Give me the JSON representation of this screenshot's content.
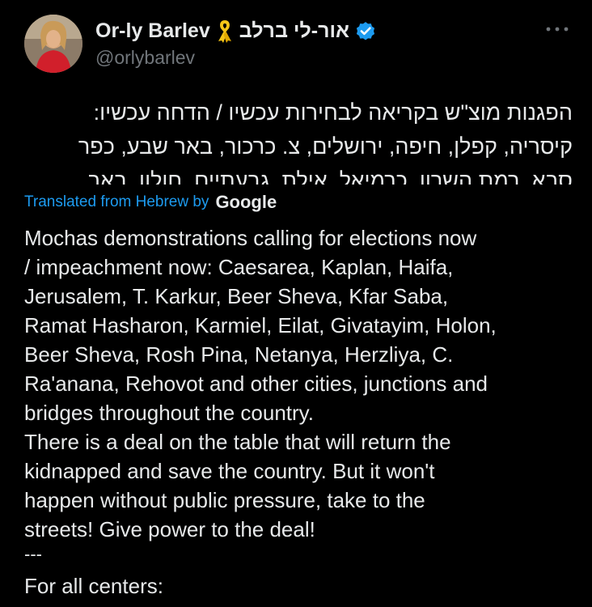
{
  "author": {
    "display_name": "Or-ly Barlev",
    "hebrew_name": "אור-לי ברלב",
    "handle": "@orlybarlev",
    "avatar_icon": "profile-photo",
    "ribbon_icon": "yellow-ribbon-icon",
    "verified_icon": "verified-badge-icon",
    "verified_color": "#1d9bf0",
    "ribbon_color": "#f5c518"
  },
  "tweet": {
    "hebrew_lines": [
      "הפגנות מוצ\"ש בקריאה לבחירות עכשיו / הדחה עכשיו:",
      "קיסריה, קפלן, חיפה, ירושלים, צ. כרכור, באר שבע, כפר",
      "סבא, רמת השרון, כרמיאל, אילת, גבעתיים, חולון, באר"
    ],
    "translated_label": "Translated from Hebrew by",
    "translator": "Google",
    "english_lines": [
      "Mochas demonstrations calling for elections now",
      "/ impeachment now: Caesarea, Kaplan, Haifa,",
      "Jerusalem, T. Karkur, Beer Sheva, Kfar Saba,",
      "Ramat Hasharon, Karmiel, Eilat, Givatayim, Holon,",
      "Beer Sheva, Rosh Pina, Netanya, Herzliya, C.",
      "Ra'anana, Rehovot and other cities, junctions and",
      "bridges throughout the country.",
      "There is a deal on the table that will return the",
      "kidnapped and save the country. But it won't",
      "happen without public pressure, take to the",
      "streets! Give power to the deal!"
    ],
    "separator": "---",
    "centers_text": "For all centers:"
  },
  "colors": {
    "background": "#000000",
    "text": "#e7e9ea",
    "secondary": "#71767b",
    "link": "#1d9bf0"
  },
  "more_icon": "more-options-icon"
}
